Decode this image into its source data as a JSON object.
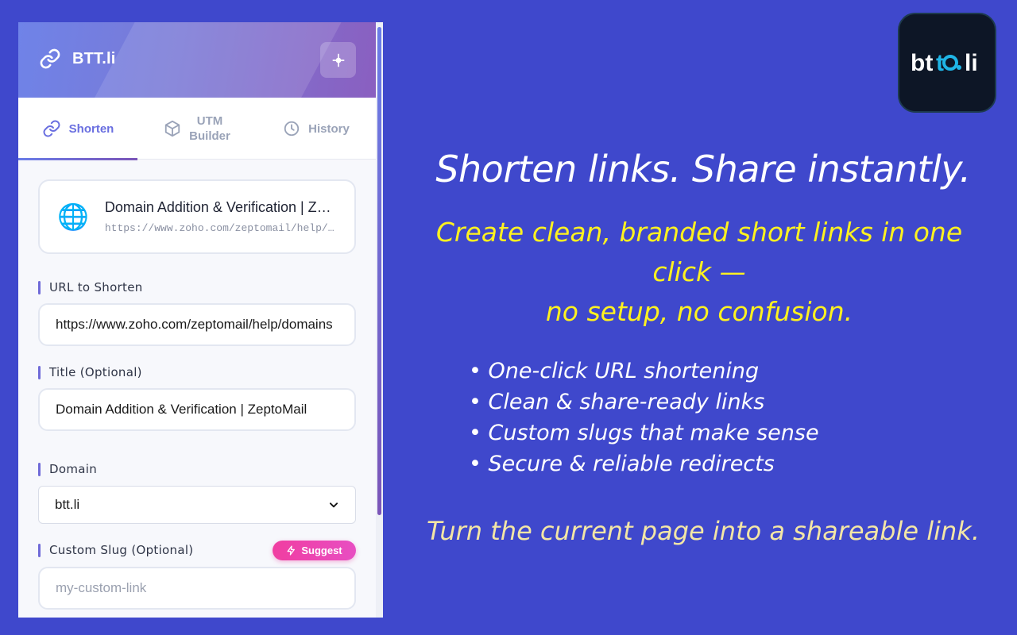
{
  "popup": {
    "brand_title": "BTT.li",
    "tabs": [
      {
        "label": "Shorten",
        "icon": "link-icon",
        "active": true
      },
      {
        "label_line1": "UTM",
        "label_line2": "Builder",
        "icon": "cube-icon",
        "active": false
      },
      {
        "label": "History",
        "icon": "clock-icon",
        "active": false
      }
    ],
    "preview": {
      "icon": "globe-icon",
      "title": "Domain Addition & Verification | ZeptoMail",
      "url": "https://www.zoho.com/zeptomail/help/domains.html"
    },
    "fields": {
      "url_label": "URL to Shorten",
      "url_value": "https://www.zoho.com/zeptomail/help/domains",
      "title_label": "Title (Optional)",
      "title_value": "Domain Addition & Verification | ZeptoMail",
      "domain_label": "Domain",
      "domain_value": "btt.li",
      "slug_label": "Custom Slug (Optional)",
      "slug_placeholder": "my-custom-link",
      "suggest_label": "Suggest"
    }
  },
  "logo": {
    "text": "btt.li"
  },
  "marketing": {
    "headline": "Shorten links. Share instantly.",
    "subline_1": "Create clean, branded short links in one",
    "subline_2": "click —",
    "subline_3": "no setup, no confusion.",
    "features": [
      "• One-click URL shortening",
      "• Clean & share-ready links",
      "• Custom slugs that make sense",
      "• Secure & reliable redirects"
    ],
    "cta": "Turn the current page into a shareable link."
  },
  "colors": {
    "background": "#3f48cc",
    "accent": "#6a6fe0",
    "headline": "#ffffff",
    "subline": "#fff21f",
    "cta": "#f3e6a6",
    "suggest": "#f03ea1"
  }
}
